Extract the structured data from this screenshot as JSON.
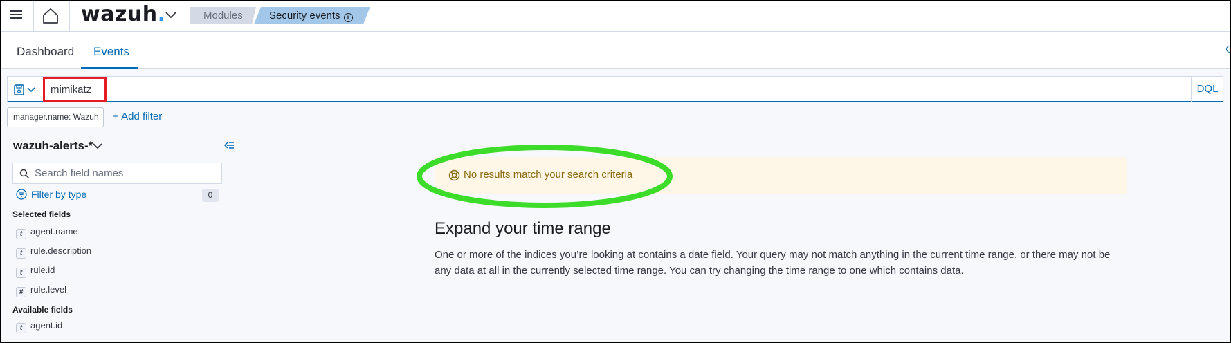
{
  "header": {
    "logo_text": "wazuh",
    "logo_dot": ".",
    "breadcrumbs": [
      "Modules",
      "Security events"
    ]
  },
  "tabs": [
    {
      "label": "Dashboard",
      "active": false
    },
    {
      "label": "Events",
      "active": true
    }
  ],
  "query": {
    "value": "mimikatz",
    "language": "DQL"
  },
  "filters": {
    "pill": "manager.name: Wazuh",
    "add_label": "+ Add filter"
  },
  "sidebar": {
    "index_pattern": "wazuh-alerts-*",
    "search_placeholder": "Search field names",
    "filter_by_type": "Filter by type",
    "filter_count": "0",
    "selected_title": "Selected fields",
    "selected_fields": [
      {
        "type": "t",
        "name": "agent.name"
      },
      {
        "type": "t",
        "name": "rule.description"
      },
      {
        "type": "t",
        "name": "rule.id"
      },
      {
        "type": "#",
        "name": "rule.level"
      }
    ],
    "available_title": "Available fields",
    "available_fields": [
      {
        "type": "t",
        "name": "agent.id"
      }
    ]
  },
  "main": {
    "callout": "No results match your search criteria",
    "expand_title": "Expand your time range",
    "expand_body": "One or more of the indices you’re looking at contains a date field. Your query may not match anything in the current time range, or there may not be any data at all in the currently selected time range. You can try changing the time range to one which contains data."
  },
  "colors": {
    "accent": "#006bb8",
    "highlight_red": "#e51c23",
    "highlight_green": "#3ddc2a",
    "callout_bg": "#fef6e6"
  }
}
